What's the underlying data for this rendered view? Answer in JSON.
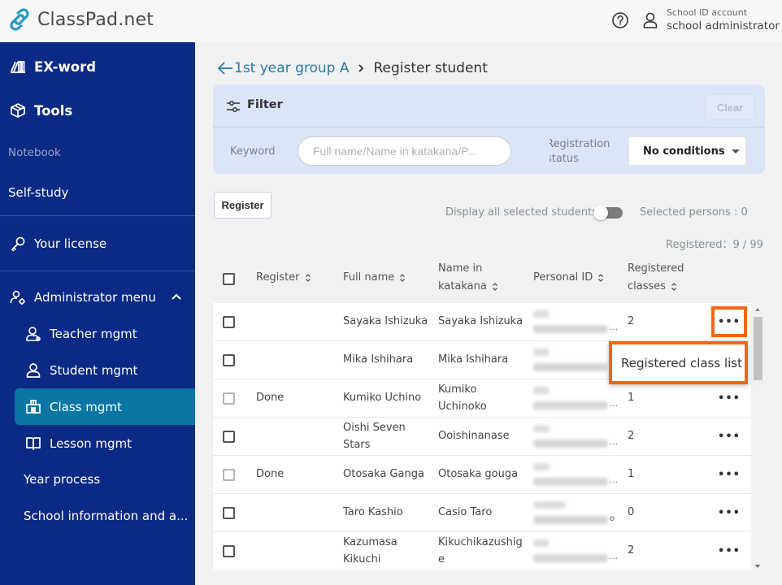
{
  "header": {
    "brand": "ClassPad.net",
    "account_type": "School ID account",
    "account_role": "school administrator",
    "icons": [
      "help-circle-icon",
      "user-icon"
    ]
  },
  "sidebar": {
    "items": [
      {
        "label": "EX-word",
        "icon": "ex-word-icon",
        "style": "bold"
      },
      {
        "label": "Tools",
        "icon": "tools-box-icon",
        "style": "bold"
      },
      {
        "label": "Notebook",
        "style": "dim"
      },
      {
        "label": "Self-study",
        "style": "normal"
      },
      {
        "label": "Your license",
        "icon": "key-icon",
        "style": "normal"
      },
      {
        "label": "Administrator menu",
        "icon": "admin-user-gear-icon",
        "style": "normal",
        "expanded": true
      }
    ],
    "admin_submenu": [
      {
        "label": "Teacher mgmt",
        "icon": "teacher-icon"
      },
      {
        "label": "Student mgmt",
        "icon": "student-icon"
      },
      {
        "label": "Class mgmt",
        "icon": "class-icon",
        "active": true
      },
      {
        "label": "Lesson mgmt",
        "icon": "book-icon"
      },
      {
        "label": "Year process"
      },
      {
        "label": "School information and a..."
      }
    ],
    "colors": {
      "background": "#0b2a85",
      "active": "#0a76a3"
    }
  },
  "breadcrumb": {
    "parent": "1st year group A",
    "current": "Register student"
  },
  "filter": {
    "title": "Filter",
    "clear_label": "Clear",
    "keyword_label": "Keyword",
    "keyword_placeholder": "Full name/Name in katakana/P...",
    "keyword_value": "",
    "status_label_line1": "Registration",
    "status_label_line2": "status",
    "status_selected": "No conditions"
  },
  "toolbar": {
    "register_label": "Register",
    "display_all_label": "Display all selected students",
    "display_all_on": false,
    "selected_persons": "Selected persons : 0",
    "registered_count": "Registered：9 / 99"
  },
  "table": {
    "columns": [
      {
        "label": "Register",
        "sortable": true
      },
      {
        "label": "Full name",
        "sortable": true
      },
      {
        "label_line1": "Name in",
        "label_line2": "katakana",
        "sortable": true
      },
      {
        "label": "Personal ID",
        "sortable": true
      },
      {
        "label_line1": "Registered",
        "label_line2": "classes",
        "sortable": true
      }
    ],
    "rows": [
      {
        "register": "",
        "full_name": "Sayaka Ishizuka",
        "katakana": "Sayaka Ishizuka",
        "personal_id": "[blurred]",
        "classes": "2",
        "checkbox_disabled": false
      },
      {
        "register": "",
        "full_name": "Mika Ishihara",
        "katakana": "Mika Ishihara",
        "personal_id": "[blurred]",
        "classes": "",
        "checkbox_disabled": false
      },
      {
        "register": "Done",
        "full_name": "Kumiko Uchino",
        "katakana": "Kumiko Uchinoko",
        "personal_id": "[blurred]",
        "classes": "1",
        "checkbox_disabled": true
      },
      {
        "register": "",
        "full_name": "Oishi Seven Stars",
        "katakana": "Ooishinanase",
        "personal_id": "[blurred]",
        "classes": "2",
        "checkbox_disabled": false
      },
      {
        "register": "Done",
        "full_name": "Otosaka Ganga",
        "katakana": "Otosaka gouga",
        "personal_id": "[blurred]",
        "classes": "1",
        "checkbox_disabled": true
      },
      {
        "register": "",
        "full_name": "Taro Kashio",
        "katakana": "Casio Taro",
        "personal_id": "[blurred]",
        "classes": "0",
        "checkbox_disabled": false
      },
      {
        "register": "",
        "full_name": "Kazumasa Kikuchi",
        "katakana": "Kikuchikazushige",
        "personal_id": "[blurred]",
        "classes": "2",
        "checkbox_disabled": false
      }
    ],
    "more_label": "•••"
  },
  "context_menu": {
    "items": [
      "Registered class list"
    ],
    "highlight_color": "#f0670f"
  }
}
